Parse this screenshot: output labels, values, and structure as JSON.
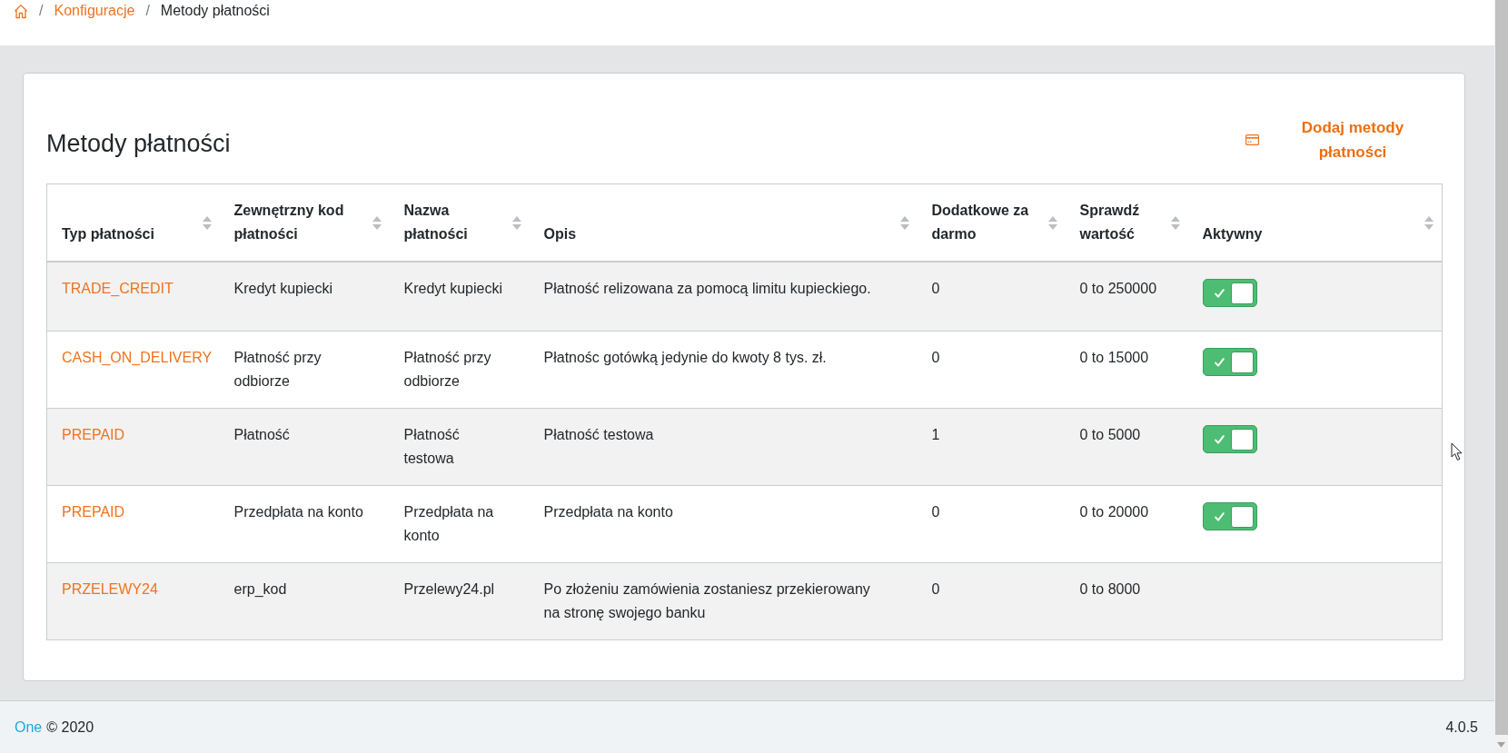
{
  "breadcrumb": [
    {
      "kind": "home"
    },
    {
      "kind": "separator",
      "text": "/"
    },
    {
      "kind": "link",
      "text": "Konfiguracje"
    },
    {
      "kind": "separator",
      "text": "/"
    },
    {
      "kind": "current",
      "text": "Metody płatności"
    }
  ],
  "card": {
    "title": "Metody płatności",
    "add_button": "Dodaj metody płatności"
  },
  "table": {
    "columns": [
      "Typ płatności",
      "Zewnętrzny kod płatności",
      "Nazwa płatności",
      "Opis",
      "Dodatkowe za darmo",
      "Sprawdź wartość",
      "Aktywny"
    ],
    "rows": [
      {
        "payment_type": "TRADE_CREDIT",
        "external_code": "Kredyt kupiecki",
        "name": "Kredyt kupiecki",
        "description": "Płatność relizowana za pomocą limitu kupieckiego.",
        "free_extras": "0",
        "value_range": "0 to 250000",
        "active": true
      },
      {
        "payment_type": "CASH_ON_DELIVERY",
        "external_code": "Płatność przy odbiorze",
        "name": "Płatność przy odbiorze",
        "description": "Płatnośc gotówką jedynie do kwoty 8 tys. zł.",
        "free_extras": "0",
        "value_range": "0 to 15000",
        "active": true
      },
      {
        "payment_type": "PREPAID",
        "external_code": "Płatność",
        "name": "Płatność testowa",
        "description": "Płatność testowa",
        "free_extras": "1",
        "value_range": "0 to 5000",
        "active": true
      },
      {
        "payment_type": "PREPAID",
        "external_code": "Przedpłata na konto",
        "name": "Przedpłata na konto",
        "description": "Przedpłata na konto",
        "free_extras": "0",
        "value_range": "0 to 20000",
        "active": true
      },
      {
        "payment_type": "PRZELEWY24",
        "external_code": "erp_kod",
        "name": "Przelewy24.pl",
        "description": "Po złożeniu zamówienia zostaniesz przekierowany na stronę swojego banku",
        "free_extras": "0",
        "value_range": "0 to 8000"
      }
    ]
  },
  "footer": {
    "brand": "One",
    "copyright": "© 2020",
    "version": "4.0.5"
  }
}
